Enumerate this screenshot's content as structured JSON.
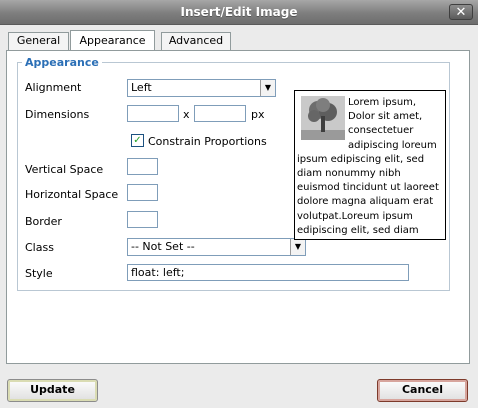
{
  "window": {
    "title": "Insert/Edit Image",
    "close_glyph": "✕"
  },
  "tabs": [
    {
      "label": "General",
      "active": false
    },
    {
      "label": "Appearance",
      "active": true
    },
    {
      "label": "Advanced",
      "active": false
    }
  ],
  "appearance": {
    "legend": "Appearance",
    "alignment": {
      "label": "Alignment",
      "value": "Left"
    },
    "dimensions": {
      "label": "Dimensions",
      "width": "",
      "height": "",
      "separator": "x",
      "unit": "px"
    },
    "constrain": {
      "label": "Constrain Proportions",
      "checked": true
    },
    "vspace": {
      "label": "Vertical Space",
      "value": ""
    },
    "hspace": {
      "label": "Horizontal Space",
      "value": ""
    },
    "border": {
      "label": "Border",
      "value": ""
    },
    "class": {
      "label": "Class",
      "value": "-- Not Set --"
    },
    "style": {
      "label": "Style",
      "value": "float: left;"
    },
    "preview_text": "Lorem ipsum, Dolor sit amet, consectetuer adipiscing loreum ipsum edipiscing elit, sed diam nonummy nibh euismod tincidunt ut laoreet dolore magna aliquam erat volutpat.Loreum ipsum edipiscing elit, sed diam"
  },
  "buttons": {
    "update": "Update",
    "cancel": "Cancel"
  },
  "icons": {
    "close": "close-icon",
    "dropdown": "chevron-down-icon",
    "check": "checkmark-icon",
    "preview": "tree-image-icon"
  },
  "colors": {
    "legend": "#2b6fb6",
    "titlebar": "#7e7e7e",
    "cancel_border": "#d7a59d"
  }
}
